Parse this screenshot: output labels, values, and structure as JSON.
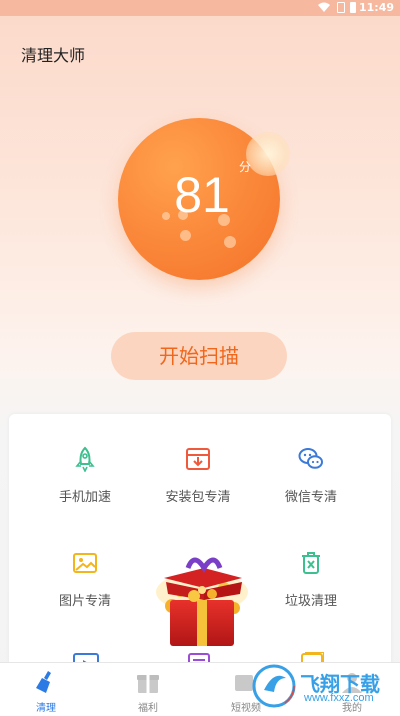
{
  "status_bar": {
    "time": "11:49"
  },
  "header": {
    "title": "清理大师"
  },
  "score": {
    "value": "81",
    "unit": "分"
  },
  "scan_button": {
    "label": "开始扫描"
  },
  "tools": [
    {
      "label": "手机加速",
      "icon": "rocket-icon",
      "color": "#3dbf8f"
    },
    {
      "label": "安装包专清",
      "icon": "package-download-icon",
      "color": "#f05a3c"
    },
    {
      "label": "微信专清",
      "icon": "wechat-icon",
      "color": "#3b7ad9"
    },
    {
      "label": "图片专清",
      "icon": "image-icon",
      "color": "#f3b51e"
    },
    {
      "label": "垃圾清理",
      "icon": "trash-icon",
      "color": "#3dbf8f"
    }
  ],
  "tabs": [
    {
      "label": "清理",
      "icon": "broom-icon",
      "active": true
    },
    {
      "label": "福利",
      "icon": "gift-icon",
      "active": false
    },
    {
      "label": "短视频",
      "icon": "video-icon",
      "active": false
    },
    {
      "label": "我的",
      "icon": "profile-icon",
      "active": false
    }
  ],
  "watermark": {
    "text": "飞翔下载",
    "url": "www.fxxz.com"
  },
  "colors": {
    "accent": "#f0671c",
    "tab_active": "#2c7be5"
  }
}
